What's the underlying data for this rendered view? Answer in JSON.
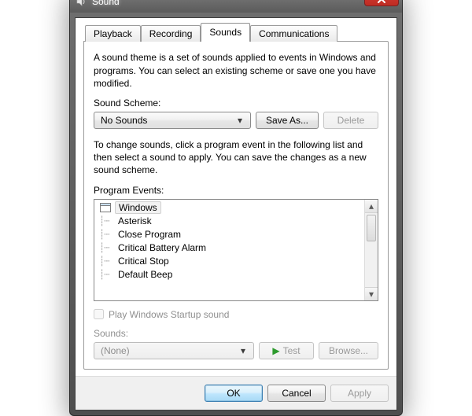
{
  "window": {
    "title": "Sound"
  },
  "tabs": {
    "t0": "Playback",
    "t1": "Recording",
    "t2": "Sounds",
    "t3": "Communications",
    "selected_index": 2
  },
  "content": {
    "intro": "A sound theme is a set of sounds applied to events in Windows and programs.  You can select an existing scheme or save one you have modified.",
    "scheme_label": "Sound Scheme:",
    "scheme_value": "No Sounds",
    "save_as": "Save As...",
    "delete": "Delete",
    "change_desc": "To change sounds, click a program event in the following list and then select a sound to apply.  You can save the changes as a new sound scheme.",
    "events_label": "Program Events:",
    "tree": {
      "root": "Windows",
      "items": [
        "Asterisk",
        "Close Program",
        "Critical Battery Alarm",
        "Critical Stop",
        "Default Beep"
      ]
    },
    "startup_checkbox": "Play Windows Startup sound",
    "sounds_label": "Sounds:",
    "sounds_value": "(None)",
    "test": "Test",
    "browse": "Browse..."
  },
  "footer": {
    "ok": "OK",
    "cancel": "Cancel",
    "apply": "Apply"
  }
}
